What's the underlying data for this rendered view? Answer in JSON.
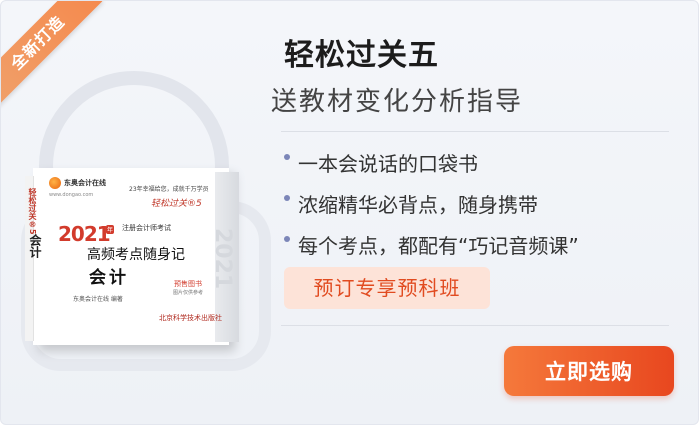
{
  "ribbon": {
    "label": "全新打造"
  },
  "header": {
    "title": "轻松过关五",
    "subtitle": "送教材变化分析指导"
  },
  "features": [
    "一本会说话的口袋书",
    "浓缩精华必背点，随身携带",
    "每个考点，都配有“巧记音频课”"
  ],
  "promo": {
    "label": "预订专享预科班"
  },
  "buy_button": {
    "label": "立即选购"
  },
  "book": {
    "logo_text": "东奥会计在线",
    "logo_url": "www.dongao.com",
    "slogan": "23年幸福给您，成就千万学员",
    "handwriting": "轻松过关®5",
    "year": "2021",
    "year_tag": "年",
    "exam": "注册会计师考试",
    "main_title": "高频考点随身记",
    "subject": "会计",
    "badge_line1": "预售图书",
    "badge_line2": "图片仅供参考",
    "author": "东奥会计在线  编著",
    "publisher": "北京科学技术出版社",
    "spine_year": "2021",
    "edge_title": "轻松过关®5",
    "edge_subject": "会计",
    "accent_color": "#d23b2c"
  },
  "colors": {
    "button_gradient_start": "#f5793b",
    "button_gradient_end": "#e8471f",
    "promo_bg": "#fde3d8",
    "promo_text": "#e14b20",
    "ribbon": "#f58a4e"
  }
}
